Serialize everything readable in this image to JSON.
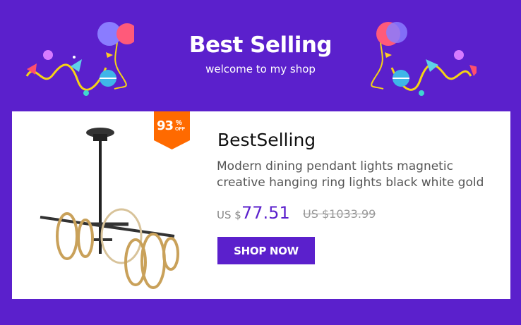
{
  "banner": {
    "title": "Best Selling",
    "subtitle": "welcome to my shop"
  },
  "product": {
    "badge_percent": "93",
    "badge_symbol": "%",
    "badge_off": "OFF",
    "title": "BestSelling",
    "description": "Modern dining pendant lights magnetic creative hanging ring lights black white gold ring LED light dining room living room kitchen",
    "currency_label": "US $",
    "price": "77.51",
    "old_price": "US $1033.99",
    "shop_button_label": "SHOP NOW"
  },
  "colors": {
    "brand_purple": "#5b20cc",
    "badge_orange": "#ff6a00"
  },
  "icons": {
    "decor_left": "balloons-confetti-icon",
    "decor_right": "balloons-confetti-icon",
    "product": "pendant-ring-light-image"
  }
}
